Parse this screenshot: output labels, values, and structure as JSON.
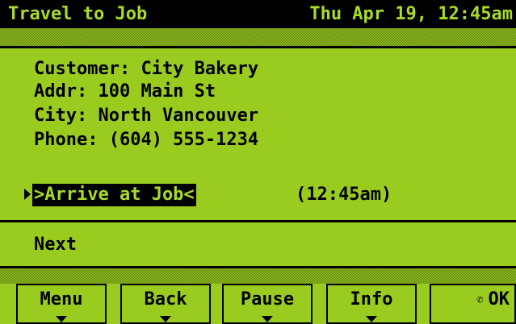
{
  "header": {
    "title": "Travel to Job",
    "datetime": "Thu Apr 19, 12:45am"
  },
  "customer": {
    "customer_line": "Customer: City Bakery",
    "addr_line": "Addr: 100 Main St",
    "city_line": "City: North Vancouver",
    "phone_line": "Phone: (604) 555-1234"
  },
  "action": {
    "label": ">Arrive at Job<",
    "time": "(12:45am)"
  },
  "next": {
    "label": "Next"
  },
  "softkeys": [
    {
      "label": "Menu"
    },
    {
      "label": "Back"
    },
    {
      "label": "Pause"
    },
    {
      "label": "Info"
    },
    {
      "label": "OK",
      "icon": "phone-icon"
    }
  ],
  "colors": {
    "screen_bg": "#9ACC1F",
    "ink": "#000000",
    "inverse_text": "#A8DC28"
  }
}
